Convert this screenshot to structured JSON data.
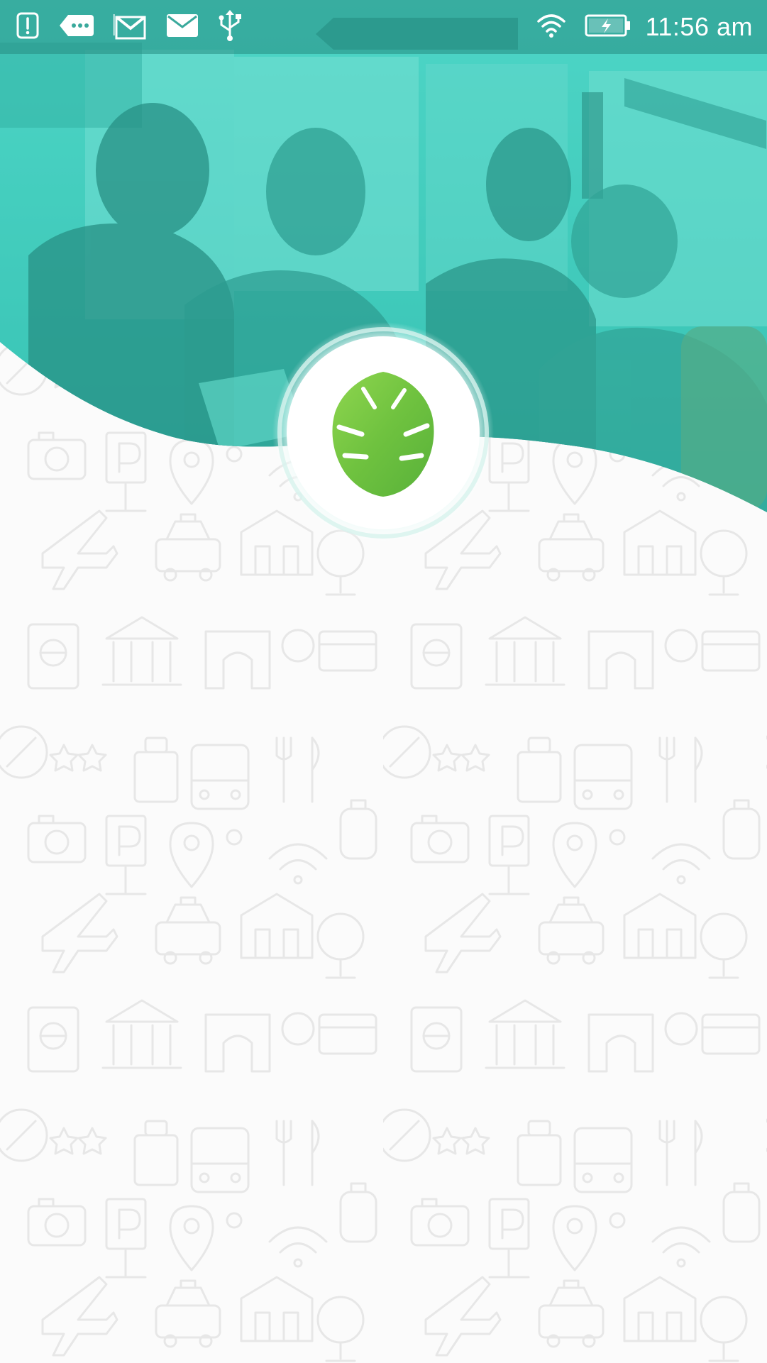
{
  "status_bar": {
    "time": "11:56 am",
    "left_icons": [
      "alert-notification-icon",
      "message-bubble-icon",
      "gmail-icon",
      "email-icon",
      "usb-icon"
    ],
    "right_icons": [
      "wifi-icon",
      "battery-charging-icon"
    ]
  },
  "hero": {
    "overlay_color": "#3fd1c1",
    "image": "travelers-group-photo"
  },
  "logo": {
    "icon": "monstera-leaf-logo-icon",
    "color": "#7cc94a"
  },
  "background": {
    "pattern": "travel-icons-pattern"
  }
}
